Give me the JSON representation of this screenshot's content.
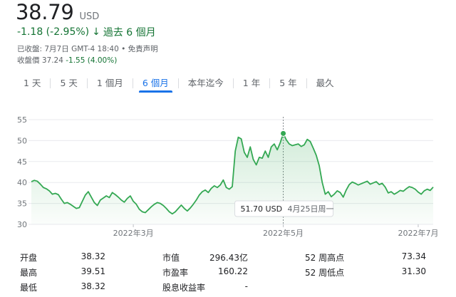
{
  "quote": {
    "price": "38.79",
    "currency": "USD",
    "change": "-1.18 (-2.95%)",
    "change_arrow": "↓",
    "period": "過去 6 個月",
    "close_line": "已收盤: 7月7日 GMT-4 18:40 • 免責声明",
    "after_hours_label": "收盤價 37.24",
    "after_hours_change": "-1.55 (4.00%)"
  },
  "tabs": [
    {
      "label": "1 天",
      "active": false
    },
    {
      "label": "5 天",
      "active": false
    },
    {
      "label": "1 個月",
      "active": false
    },
    {
      "label": "6 個月",
      "active": true
    },
    {
      "label": "本年迄今",
      "active": false
    },
    {
      "label": "1 年",
      "active": false
    },
    {
      "label": "5 年",
      "active": false
    },
    {
      "label": "最久",
      "active": false
    }
  ],
  "colors": {
    "line": "#34a853",
    "fill_top": "#34a853",
    "axis_text": "#70757a",
    "grid": "#e8eaed",
    "change": "#137333",
    "active_tab": "#1a73e8"
  },
  "chart_data": {
    "type": "area",
    "ylim": [
      30,
      55
    ],
    "yticks": [
      30,
      35,
      40,
      45,
      50,
      55
    ],
    "xticks": [
      {
        "label": "2022年3月",
        "index": 34
      },
      {
        "label": "2022年5月",
        "index": 84
      },
      {
        "label": "2022年7月",
        "index": 129
      }
    ],
    "values": [
      40.2,
      40.5,
      40.3,
      39.6,
      38.8,
      38.5,
      38.0,
      37.2,
      37.4,
      37.1,
      36.0,
      35.0,
      35.2,
      34.8,
      34.3,
      33.8,
      34.0,
      35.5,
      37.0,
      37.8,
      36.5,
      35.2,
      34.5,
      35.8,
      36.3,
      36.8,
      36.4,
      37.6,
      37.1,
      36.5,
      35.8,
      35.3,
      36.2,
      36.8,
      35.5,
      34.8,
      33.6,
      33.0,
      32.8,
      33.5,
      34.2,
      34.8,
      35.2,
      35.0,
      34.5,
      33.8,
      33.0,
      32.5,
      33.0,
      33.8,
      34.6,
      33.8,
      33.2,
      33.9,
      34.8,
      35.8,
      37.0,
      37.8,
      38.2,
      37.6,
      38.6,
      39.2,
      38.8,
      39.4,
      40.6,
      38.8,
      38.4,
      39.0,
      47.5,
      50.8,
      50.4,
      47.2,
      46.0,
      48.5,
      45.5,
      44.2,
      46.0,
      45.8,
      47.5,
      46.0,
      48.5,
      49.2,
      47.8,
      49.5,
      51.7,
      50.2,
      49.2,
      48.8,
      49.0,
      49.2,
      48.6,
      49.0,
      50.3,
      49.8,
      48.2,
      46.5,
      44.0,
      40.0,
      37.2,
      37.8,
      36.6,
      37.2,
      38.0,
      37.6,
      36.5,
      38.2,
      39.5,
      40.1,
      39.8,
      39.4,
      39.7,
      40.0,
      40.3,
      39.6,
      39.9,
      40.2,
      39.5,
      39.8,
      38.9,
      37.5,
      37.8,
      37.2,
      37.6,
      38.1,
      37.9,
      38.5,
      39.0,
      38.8,
      38.4,
      37.7,
      37.2,
      38.0,
      38.4,
      38.1,
      38.9
    ],
    "prev_close_hint": "",
    "hover": {
      "index": 84,
      "price": "51.70 USD",
      "date": "4月25日周一"
    }
  },
  "stats": {
    "rows": [
      [
        {
          "label": "开盘",
          "value": "38.32"
        },
        {
          "label": "市值",
          "value": "296.43亿"
        },
        {
          "label": "52 周高点",
          "value": "73.34"
        }
      ],
      [
        {
          "label": "最高",
          "value": "39.51"
        },
        {
          "label": "市盈率",
          "value": "160.22"
        },
        {
          "label": "52 周低点",
          "value": "31.30"
        }
      ],
      [
        {
          "label": "最低",
          "value": "38.32"
        },
        {
          "label": "股息收益率",
          "value": "-"
        },
        {
          "label": "",
          "value": ""
        }
      ]
    ]
  }
}
